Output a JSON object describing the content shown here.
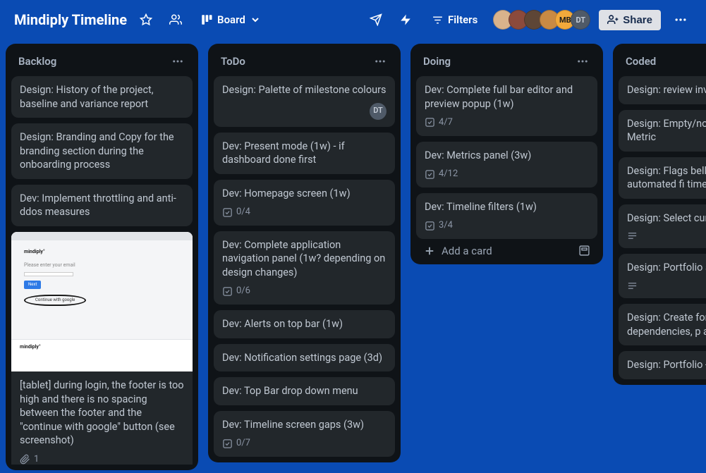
{
  "header": {
    "board_title": "Mindiply Timeline",
    "view_label": "Board",
    "filters_label": "Filters",
    "share_label": "Share",
    "avatars": [
      {
        "bg": "#d9b38c"
      },
      {
        "bg": "#8b4a3c"
      },
      {
        "bg": "#5e4636"
      },
      {
        "bg": "#c98a44"
      },
      {
        "bg": "#f2a93b",
        "text": "MB",
        "fg": "#1d1d1d"
      },
      {
        "bg": "#4f5a68",
        "text": "DT",
        "fg": "#c5ccd6"
      }
    ]
  },
  "lists": [
    {
      "title": "Backlog",
      "cards": [
        {
          "text": "Design: History of the project, baseline and variance report"
        },
        {
          "text": "Design: Branding and Copy for the branding section during the onboarding process"
        },
        {
          "text": "Dev: Implement throttling and anti-ddos measures"
        },
        {
          "cover": true,
          "text": "[tablet] during login, the footer is too high and there is no spacing between the footer and the \"continue with google\" button (see screenshot)",
          "attach": "1"
        }
      ]
    },
    {
      "title": "ToDo",
      "cards": [
        {
          "text": "Design: Palette of milestone colours",
          "member": "DT"
        },
        {
          "text": "Dev: Present mode (1w) - if dashboard done first"
        },
        {
          "text": "Dev: Homepage screen (1w)",
          "check": "0/4"
        },
        {
          "text": "Dev: Complete application navigation panel (1w? depending on design changes)",
          "check": "0/6"
        },
        {
          "text": "Dev: Alerts on top bar (1w)"
        },
        {
          "text": "Dev: Notification settings page (3d)"
        },
        {
          "text": "Dev: Top Bar drop down menu"
        },
        {
          "text": "Dev: Timeline screen gaps (3w)",
          "check": "0/7"
        }
      ]
    },
    {
      "title": "Doing",
      "add_card_label": "Add a card",
      "cards": [
        {
          "text": "Dev: Complete full bar editor and preview popup (1w)",
          "check": "4/7"
        },
        {
          "text": "Dev: Metrics panel (3w)",
          "check": "4/12"
        },
        {
          "text": "Dev: Timeline filters (1w)",
          "check": "3/4"
        }
      ]
    },
    {
      "title": "Coded",
      "cards": [
        {
          "text": "Design: review invi"
        },
        {
          "text": "Design: Empty/no d panels in the Metric"
        },
        {
          "text": "Design: Flags bell n apply automated fi timeline layout"
        },
        {
          "text": "Design: Select curr",
          "desc": true
        },
        {
          "text": "Design: Portfolio se",
          "desc": true
        },
        {
          "text": "Design: Create forn of dependencies, p activities"
        },
        {
          "text": "Design: Portfolio -"
        }
      ]
    }
  ]
}
